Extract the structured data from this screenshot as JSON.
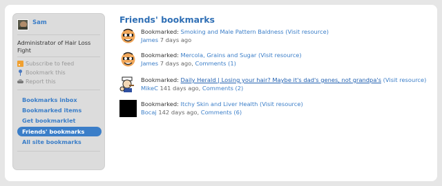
{
  "sidebar": {
    "user_name": "Sam",
    "about": "Administrator of Hair Loss Fight",
    "actions": [
      {
        "label": "Subscribe to feed",
        "icon": "rss-icon"
      },
      {
        "label": "Bookmark this",
        "icon": "pin-icon"
      },
      {
        "label": "Report this",
        "icon": "car-icon"
      }
    ],
    "nav": [
      {
        "label": "Bookmarks inbox",
        "active": false
      },
      {
        "label": "Bookmarked items",
        "active": false
      },
      {
        "label": "Get bookmarklet",
        "active": false
      },
      {
        "label": "Friends' bookmarks",
        "active": true
      },
      {
        "label": "All site bookmarks",
        "active": false
      }
    ]
  },
  "main": {
    "title": "Friends' bookmarks",
    "bookmarked_label": "Bookmarked:",
    "visit_label": "(Visit resource)",
    "items": [
      {
        "title": "Smoking and Male Pattern Baldness",
        "user": "James",
        "time": "7 days ago",
        "comments": "",
        "avatar": "cartoon-avatar",
        "underline": false
      },
      {
        "title": "Mercola, Grains and Sugar",
        "user": "James",
        "time": "7 days ago,",
        "comments": "Comments (1)",
        "avatar": "cartoon-avatar",
        "underline": false
      },
      {
        "title": "Daily Herald | Losing your hair? Maybe it's dad's genes, not grandpa's",
        "user": "MikeC",
        "time": "141 days ago,",
        "comments": "Comments (2)",
        "avatar": "popeye-avatar",
        "underline": true
      },
      {
        "title": "Itchy Skin and Liver Health",
        "user": "Bocaj",
        "time": "142 days ago,",
        "comments": "Comments (6)",
        "avatar": "black-avatar",
        "underline": false
      }
    ]
  },
  "colors": {
    "accent": "#3b7ec8",
    "title": "#2f6fb5",
    "sidebar_bg": "#dcdcdc",
    "page_bg": "#e6e6e6"
  }
}
